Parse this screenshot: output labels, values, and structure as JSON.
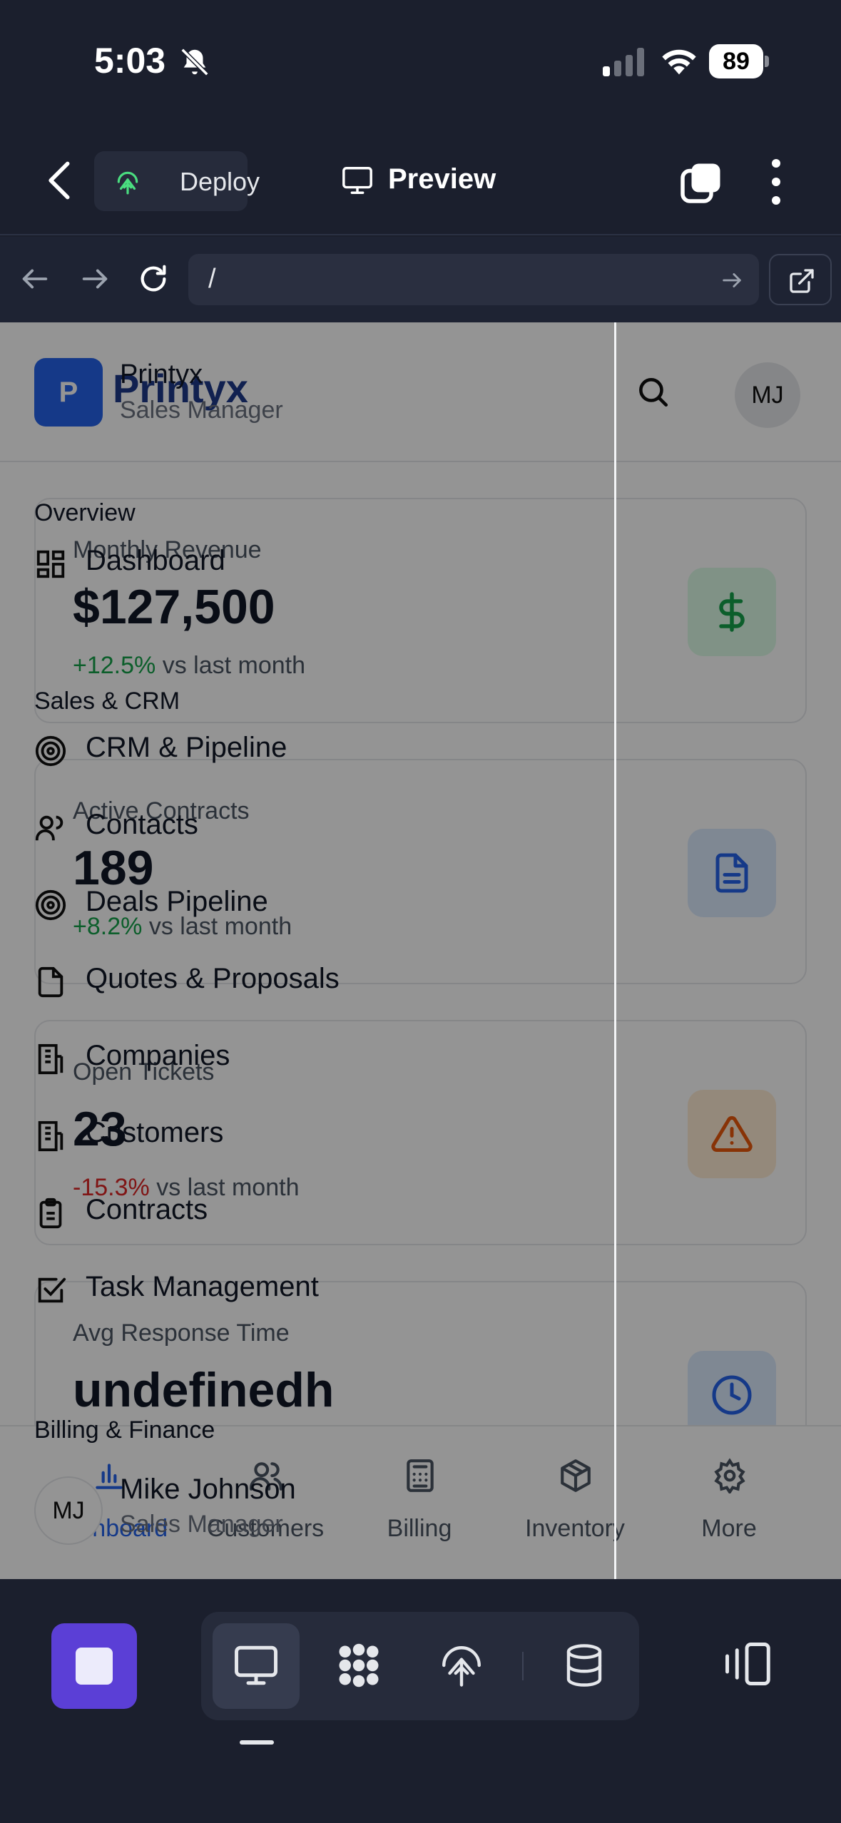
{
  "status_bar": {
    "time": "5:03",
    "battery": "89"
  },
  "editor_header": {
    "deploy_label": "Deploy",
    "preview_label": "Preview"
  },
  "url_bar": {
    "url": "/"
  },
  "app": {
    "logo_letter": "P",
    "brand": "Printyx",
    "header_avatar": "MJ",
    "stats": [
      {
        "title": "Monthly Revenue",
        "value": "$127,500",
        "change": "+12.5%",
        "change_suffix": "vs last month",
        "icon": "dollar-icon",
        "color": "#16a34a"
      },
      {
        "title": "Active Contracts",
        "value": "189",
        "change": "+8.2%",
        "change_suffix": "vs last month",
        "icon": "document-icon",
        "color": "#2563eb"
      },
      {
        "title": "Open Tickets",
        "value": "23",
        "change": "-15.3%",
        "change_suffix": "vs last month",
        "icon": "warning-icon",
        "color": "#ea580c"
      },
      {
        "title": "Avg Response Time",
        "value": "undefinedh",
        "icon": "clock-icon",
        "color": "#2563eb"
      }
    ],
    "bottom_nav": [
      {
        "label": "Dashboard",
        "icon": "bar-chart-icon"
      },
      {
        "label": "Customers",
        "icon": "users-icon"
      },
      {
        "label": "Billing",
        "icon": "calculator-icon"
      },
      {
        "label": "Inventory",
        "icon": "box-icon"
      },
      {
        "label": "More",
        "icon": "gear-icon"
      }
    ]
  },
  "drawer": {
    "brand": "Printyx",
    "role": "Sales Manager",
    "sections": {
      "overview": "Overview",
      "sales_crm": "Sales & CRM",
      "billing": "Billing & Finance"
    },
    "items": {
      "dashboard": "Dashboard",
      "crm_pipeline": "CRM & Pipeline",
      "contacts": "Contacts",
      "deals_pipeline": "Deals Pipeline",
      "quotes": "Quotes & Proposals",
      "companies": "Companies",
      "customers": "Customers",
      "contracts": "Contracts",
      "tasks": "Task Management"
    },
    "user": {
      "initials": "MJ",
      "name": "Mike Johnson",
      "role": "Sales Manager"
    }
  },
  "colors": {
    "accent": "#5b3fd6",
    "brand_blue": "#2563eb",
    "toolbar_bg": "#1b1f2d"
  }
}
